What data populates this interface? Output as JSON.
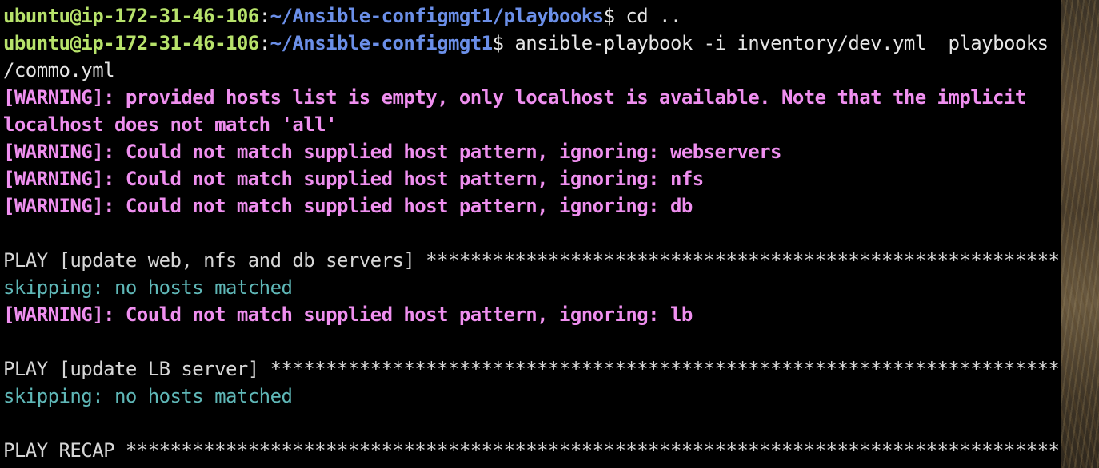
{
  "terminal": {
    "lines": [
      {
        "user_host": "ubuntu@ip-172-31-46-106",
        "path": "~/Ansible-configmgt1/playbooks",
        "prompt_symbol": "$",
        "command": " cd .."
      },
      {
        "user_host": "ubuntu@ip-172-31-46-106",
        "path": "~/Ansible-configmgt1",
        "prompt_symbol": "$",
        "command": " ansible-playbook -i inventory/dev.yml  playbooks"
      },
      {
        "text": "/commo.yml"
      },
      {
        "text": "[WARNING]: provided hosts list is empty, only localhost is available. Note that the implicit"
      },
      {
        "text": "localhost does not match 'all'"
      },
      {
        "text": "[WARNING]: Could not match supplied host pattern, ignoring: webservers"
      },
      {
        "text": "[WARNING]: Could not match supplied host pattern, ignoring: nfs"
      },
      {
        "text": "[WARNING]: Could not match supplied host pattern, ignoring: db"
      },
      {
        "text": "PLAY [update web, nfs and db servers] ************************************************************"
      },
      {
        "text": "skipping: no hosts matched"
      },
      {
        "text": "[WARNING]: Could not match supplied host pattern, ignoring: lb"
      },
      {
        "text": "PLAY [update LB server] **************************************************************************"
      },
      {
        "text": "skipping: no hosts matched"
      },
      {
        "text": "PLAY RECAP ***************************************************************************************"
      }
    ],
    "separator": ":"
  },
  "colors": {
    "background": "#000000",
    "prompt_user": "#b7e26b",
    "prompt_path": "#6b8fe8",
    "warning": "#ef8fef",
    "skipping": "#5fb7b7",
    "play_header": "#d6d6d6"
  }
}
